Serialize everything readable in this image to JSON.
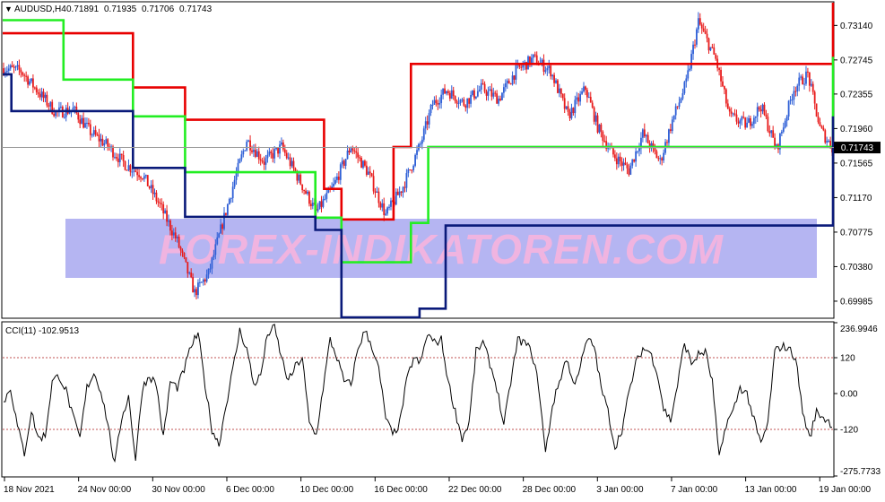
{
  "chart_data": [
    {
      "type": "candlestick",
      "header": {
        "arrow": "▼",
        "symbol": "AUDUSD,H4",
        "open": "0.71891",
        "high": "0.71935",
        "low": "0.71706",
        "close": "0.71743"
      },
      "ylim": [
        0.698,
        0.734
      ],
      "ytick_values": [
        0.7314,
        0.72745,
        0.72355,
        0.7196,
        0.71565,
        0.7117,
        0.70775,
        0.7038,
        0.69985
      ],
      "ytick_labels": [
        "0.73140",
        "0.72745",
        "0.72355",
        "0.71960",
        "0.71565",
        "0.71170",
        "0.70775",
        "0.70380",
        "0.69985"
      ],
      "current_price": "0.71743",
      "current_price_value": 0.71743,
      "watermark": "FOREX-INDIKATOREN.COM",
      "colors": {
        "bull": "#2e5fd6",
        "bear": "#e81b1b",
        "upper_channel": "#e80000",
        "middle_channel": "#22ee22",
        "lower_channel": "#0a1a7a",
        "watermark_box": "#a8a8f0",
        "watermark_text": "#f0b4e0"
      },
      "close_anchors": [
        [
          0,
          0.7265
        ],
        [
          10,
          0.7262
        ],
        [
          20,
          0.7238
        ],
        [
          30,
          0.7214
        ],
        [
          40,
          0.7218
        ],
        [
          50,
          0.7192
        ],
        [
          60,
          0.7176
        ],
        [
          70,
          0.7155
        ],
        [
          80,
          0.7143
        ],
        [
          90,
          0.7108
        ],
        [
          100,
          0.7067
        ],
        [
          110,
          0.7008
        ],
        [
          118,
          0.703
        ],
        [
          125,
          0.708
        ],
        [
          133,
          0.7137
        ],
        [
          140,
          0.7183
        ],
        [
          150,
          0.7158
        ],
        [
          160,
          0.7175
        ],
        [
          170,
          0.7138
        ],
        [
          180,
          0.71
        ],
        [
          190,
          0.713
        ],
        [
          200,
          0.7176
        ],
        [
          210,
          0.7145
        ],
        [
          220,
          0.7097
        ],
        [
          230,
          0.713
        ],
        [
          240,
          0.7178
        ],
        [
          247,
          0.7224
        ],
        [
          255,
          0.724
        ],
        [
          265,
          0.7225
        ],
        [
          275,
          0.7242
        ],
        [
          285,
          0.723
        ],
        [
          295,
          0.7262
        ],
        [
          305,
          0.7276
        ],
        [
          315,
          0.7262
        ],
        [
          325,
          0.721
        ],
        [
          335,
          0.7242
        ],
        [
          342,
          0.7198
        ],
        [
          350,
          0.7168
        ],
        [
          360,
          0.7148
        ],
        [
          368,
          0.719
        ],
        [
          378,
          0.7158
        ],
        [
          385,
          0.7205
        ],
        [
          393,
          0.7248
        ],
        [
          400,
          0.7318
        ],
        [
          410,
          0.7275
        ],
        [
          418,
          0.721
        ],
        [
          428,
          0.72
        ],
        [
          436,
          0.7222
        ],
        [
          445,
          0.7172
        ],
        [
          455,
          0.7242
        ],
        [
          463,
          0.7258
        ],
        [
          470,
          0.7196
        ],
        [
          477,
          0.7174
        ]
      ],
      "upper_channel": [
        [
          0,
          0.7305
        ],
        [
          75,
          0.7305
        ],
        [
          75,
          0.7243
        ],
        [
          105,
          0.7243
        ],
        [
          105,
          0.7206
        ],
        [
          185,
          0.7206
        ],
        [
          185,
          0.7127
        ],
        [
          195,
          0.7127
        ],
        [
          195,
          0.7092
        ],
        [
          225,
          0.7092
        ],
        [
          225,
          0.7175
        ],
        [
          235,
          0.7175
        ],
        [
          235,
          0.727
        ],
        [
          510,
          0.727
        ],
        [
          510,
          0.739
        ],
        [
          590,
          0.739
        ],
        [
          590,
          0.73
        ],
        [
          730,
          0.73
        ]
      ],
      "middle_channel": [
        [
          0,
          0.732
        ],
        [
          35,
          0.732
        ],
        [
          35,
          0.7252
        ],
        [
          75,
          0.7252
        ],
        [
          75,
          0.721
        ],
        [
          105,
          0.721
        ],
        [
          105,
          0.7146
        ],
        [
          180,
          0.7146
        ],
        [
          180,
          0.7094
        ],
        [
          195,
          0.7094
        ],
        [
          195,
          0.7043
        ],
        [
          235,
          0.7043
        ],
        [
          235,
          0.7088
        ],
        [
          245,
          0.7088
        ],
        [
          245,
          0.7175
        ],
        [
          625,
          0.7175
        ],
        [
          625,
          0.7278
        ],
        [
          672,
          0.7278
        ],
        [
          672,
          0.721
        ],
        [
          730,
          0.721
        ]
      ],
      "lower_channel": [
        [
          0,
          0.7258
        ],
        [
          5,
          0.7258
        ],
        [
          5,
          0.7216
        ],
        [
          75,
          0.7216
        ],
        [
          75,
          0.7151
        ],
        [
          105,
          0.7151
        ],
        [
          105,
          0.7095
        ],
        [
          180,
          0.7095
        ],
        [
          180,
          0.708
        ],
        [
          195,
          0.708
        ],
        [
          195,
          0.698
        ],
        [
          240,
          0.698
        ],
        [
          240,
          0.699
        ],
        [
          255,
          0.699
        ],
        [
          255,
          0.7085
        ],
        [
          625,
          0.7085
        ],
        [
          625,
          0.721
        ],
        [
          672,
          0.721
        ],
        [
          672,
          0.7112
        ],
        [
          730,
          0.7112
        ]
      ]
    },
    {
      "type": "line",
      "title": "CCI(11) -102.9513",
      "ylim": [
        -275.7733,
        236.9946
      ],
      "ytick_values": [
        236.9946,
        120,
        0,
        -120,
        -275.7733
      ],
      "ytick_labels": [
        "236.9946",
        "120",
        "0.00",
        "-120",
        "-275.7733"
      ],
      "levels": [
        120,
        -120
      ],
      "level_color": "#c05050",
      "line_color": "#000000",
      "anchors": [
        [
          0,
          -30
        ],
        [
          4,
          20
        ],
        [
          8,
          -110
        ],
        [
          12,
          -200
        ],
        [
          16,
          -60
        ],
        [
          20,
          -150
        ],
        [
          24,
          -140
        ],
        [
          28,
          40
        ],
        [
          32,
          60
        ],
        [
          36,
          10
        ],
        [
          40,
          -80
        ],
        [
          44,
          -150
        ],
        [
          48,
          20
        ],
        [
          52,
          70
        ],
        [
          56,
          10
        ],
        [
          60,
          -100
        ],
        [
          64,
          -240
        ],
        [
          68,
          -80
        ],
        [
          72,
          -10
        ],
        [
          76,
          -220
        ],
        [
          80,
          20
        ],
        [
          84,
          60
        ],
        [
          88,
          30
        ],
        [
          92,
          -150
        ],
        [
          96,
          40
        ],
        [
          100,
          20
        ],
        [
          104,
          80
        ],
        [
          108,
          160
        ],
        [
          112,
          200
        ],
        [
          116,
          30
        ],
        [
          120,
          -120
        ],
        [
          124,
          -170
        ],
        [
          128,
          -40
        ],
        [
          132,
          80
        ],
        [
          136,
          210
        ],
        [
          140,
          150
        ],
        [
          144,
          30
        ],
        [
          148,
          60
        ],
        [
          152,
          200
        ],
        [
          156,
          220
        ],
        [
          160,
          120
        ],
        [
          164,
          40
        ],
        [
          168,
          90
        ],
        [
          172,
          120
        ],
        [
          176,
          -100
        ],
        [
          180,
          -140
        ],
        [
          184,
          20
        ],
        [
          188,
          180
        ],
        [
          192,
          120
        ],
        [
          196,
          40
        ],
        [
          200,
          30
        ],
        [
          204,
          150
        ],
        [
          208,
          210
        ],
        [
          212,
          160
        ],
        [
          216,
          80
        ],
        [
          220,
          -80
        ],
        [
          224,
          -140
        ],
        [
          228,
          -100
        ],
        [
          232,
          40
        ],
        [
          236,
          120
        ],
        [
          240,
          100
        ],
        [
          244,
          200
        ],
        [
          248,
          170
        ],
        [
          252,
          180
        ],
        [
          256,
          40
        ],
        [
          260,
          -60
        ],
        [
          264,
          -150
        ],
        [
          268,
          -100
        ],
        [
          272,
          140
        ],
        [
          276,
          170
        ],
        [
          280,
          100
        ],
        [
          284,
          20
        ],
        [
          288,
          -110
        ],
        [
          292,
          40
        ],
        [
          296,
          180
        ],
        [
          300,
          170
        ],
        [
          304,
          140
        ],
        [
          308,
          30
        ],
        [
          312,
          -200
        ],
        [
          316,
          -40
        ],
        [
          320,
          40
        ],
        [
          324,
          120
        ],
        [
          328,
          30
        ],
        [
          332,
          90
        ],
        [
          336,
          180
        ],
        [
          340,
          160
        ],
        [
          344,
          20
        ],
        [
          348,
          -60
        ],
        [
          352,
          -180
        ],
        [
          356,
          -120
        ],
        [
          360,
          0
        ],
        [
          364,
          100
        ],
        [
          368,
          150
        ],
        [
          372,
          140
        ],
        [
          376,
          80
        ],
        [
          380,
          -50
        ],
        [
          384,
          -90
        ],
        [
          388,
          30
        ],
        [
          392,
          170
        ],
        [
          396,
          100
        ],
        [
          400,
          130
        ],
        [
          404,
          140
        ],
        [
          408,
          40
        ],
        [
          412,
          -220
        ],
        [
          416,
          -100
        ],
        [
          420,
          -60
        ],
        [
          424,
          20
        ],
        [
          428,
          0
        ],
        [
          432,
          -90
        ],
        [
          436,
          -170
        ],
        [
          440,
          -100
        ],
        [
          444,
          140
        ],
        [
          448,
          160
        ],
        [
          452,
          150
        ],
        [
          456,
          120
        ],
        [
          460,
          -60
        ],
        [
          464,
          -150
        ],
        [
          468,
          -60
        ],
        [
          472,
          -80
        ],
        [
          477,
          -103
        ]
      ]
    },
    {
      "type": "axis",
      "x_labels": [
        "18 Nov 2021",
        "24 Nov 00:00",
        "30 Nov 00:00",
        "6 Dec 00:00",
        "10 Dec 00:00",
        "16 Dec 00:00",
        "22 Dec 00:00",
        "28 Dec 00:00",
        "3 Jan 00:00",
        "7 Jan 00:00",
        "13 Jan 00:00",
        "19 Jan 00:00"
      ]
    }
  ]
}
